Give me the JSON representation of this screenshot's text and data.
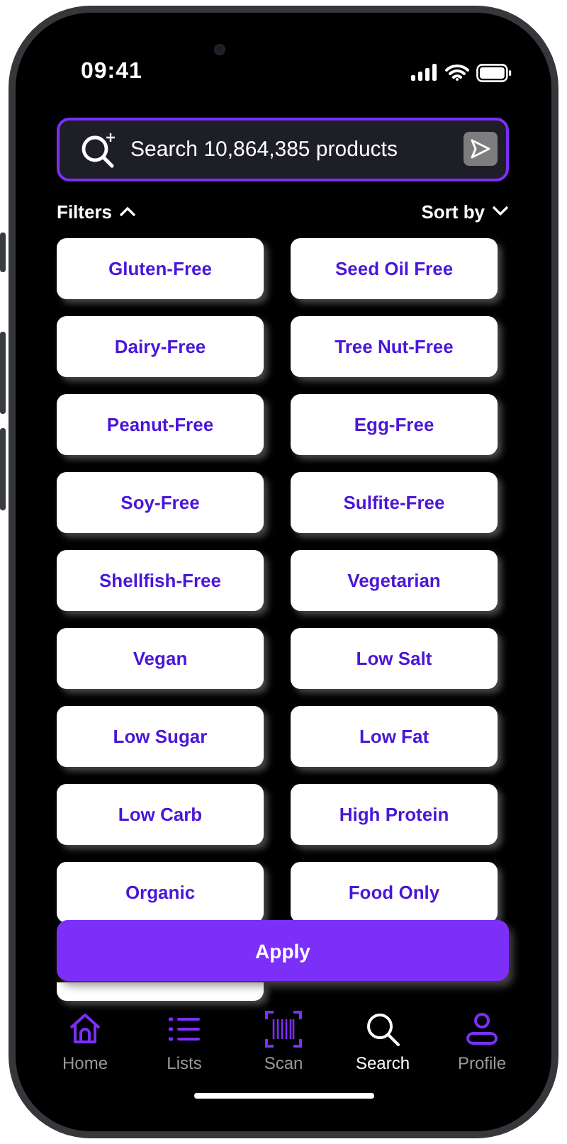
{
  "status_bar": {
    "time": "09:41"
  },
  "search": {
    "placeholder": "Search 10,864,385 products"
  },
  "filters_toggle": {
    "label": "Filters",
    "expanded": true
  },
  "sort": {
    "label": "Sort by"
  },
  "chips": [
    {
      "kind": "chip",
      "label": "Gluten-Free"
    },
    {
      "kind": "chip",
      "label": "Seed Oil Free"
    },
    {
      "kind": "chip",
      "label": "Dairy-Free"
    },
    {
      "kind": "chip",
      "label": "Tree Nut-Free"
    },
    {
      "kind": "chip",
      "label": "Peanut-Free"
    },
    {
      "kind": "chip",
      "label": "Egg-Free"
    },
    {
      "kind": "chip",
      "label": "Soy-Free"
    },
    {
      "kind": "chip",
      "label": "Sulfite-Free"
    },
    {
      "kind": "chip",
      "label": "Shellfish-Free"
    },
    {
      "kind": "chip",
      "label": "Vegetarian"
    },
    {
      "kind": "chip",
      "label": "Vegan"
    },
    {
      "kind": "chip",
      "label": "Low Salt"
    },
    {
      "kind": "chip",
      "label": "Low Sugar"
    },
    {
      "kind": "chip",
      "label": "Low Fat"
    },
    {
      "kind": "chip",
      "label": "Low Carb"
    },
    {
      "kind": "chip",
      "label": "High Protein"
    },
    {
      "kind": "chip",
      "label": "Organic"
    },
    {
      "kind": "chip",
      "label": "Food Only"
    },
    {
      "kind": "covered"
    }
  ],
  "apply_button": {
    "label": "Apply"
  },
  "tabs": [
    {
      "kind": "home",
      "label": "Home",
      "selected": false
    },
    {
      "kind": "lists",
      "label": "Lists",
      "selected": false
    },
    {
      "kind": "scan",
      "label": "Scan",
      "selected": false
    },
    {
      "kind": "search",
      "label": "Search",
      "selected": true
    },
    {
      "kind": "profile",
      "label": "Profile",
      "selected": false
    }
  ]
}
